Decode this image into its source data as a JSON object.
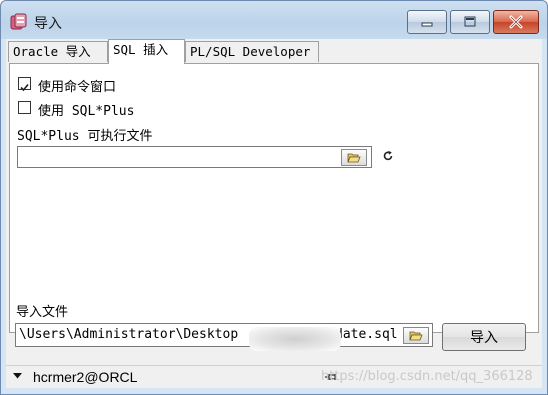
{
  "window": {
    "title": "导入"
  },
  "tabs": [
    {
      "label": "Oracle 导入"
    },
    {
      "label": "SQL 插入"
    },
    {
      "label": "PL/SQL Developer"
    }
  ],
  "options": {
    "use_command_window": {
      "label": "使用命令窗口",
      "checked": true
    },
    "use_sqlplus": {
      "label": "使用 SQL*Plus",
      "checked": false
    }
  },
  "sqlplus_exec": {
    "label": "SQL*Plus 可执行文件",
    "value": ""
  },
  "import_file": {
    "label": "导入文件",
    "value_start": "\\Users\\Administrator\\Desktop",
    "value_end": "date.sql"
  },
  "import_button": {
    "label": "导入"
  },
  "status": {
    "connection": "hcrmer2@ORCL",
    "watermark": "https://blog.csdn.net/qq_366128"
  },
  "colors": {
    "title_bar": "#bcd3ea",
    "close_button": "#c5442a",
    "panel": "#ffffff"
  },
  "icons": [
    "app-icon",
    "minimize-icon",
    "maximize-icon",
    "close-icon",
    "folder-open-icon",
    "refresh-icon",
    "dropdown-arrow-icon",
    "pin-icon"
  ]
}
